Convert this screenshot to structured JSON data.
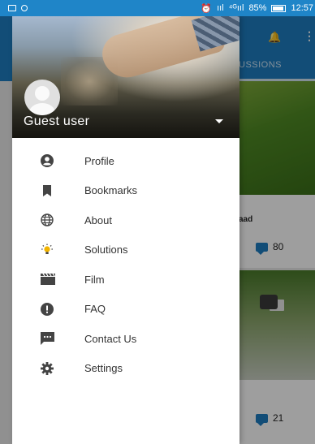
{
  "status_bar": {
    "signal": "ııl",
    "signal_secondary": "⁴ᴳııl",
    "battery": "85%",
    "time": "12:57"
  },
  "background_app": {
    "tab": "USSIONS",
    "post_title_fragment": "aad",
    "comment_counts": [
      "80",
      "21"
    ],
    "colors": {
      "app_bar": "#1e7dc1",
      "comment_icon": "#1e7dc1"
    }
  },
  "drawer": {
    "user": {
      "name": "Guest user"
    },
    "menu": [
      {
        "label": "Profile",
        "icon": "account-circle-icon"
      },
      {
        "label": "Bookmarks",
        "icon": "bookmark-icon"
      },
      {
        "label": "About",
        "icon": "globe-icon"
      },
      {
        "label": "Solutions",
        "icon": "lightbulb-icon"
      },
      {
        "label": "Film",
        "icon": "film-icon"
      },
      {
        "label": "FAQ",
        "icon": "alert-circle-icon"
      },
      {
        "label": "Contact Us",
        "icon": "message-icon"
      },
      {
        "label": "Settings",
        "icon": "gear-icon"
      }
    ]
  }
}
